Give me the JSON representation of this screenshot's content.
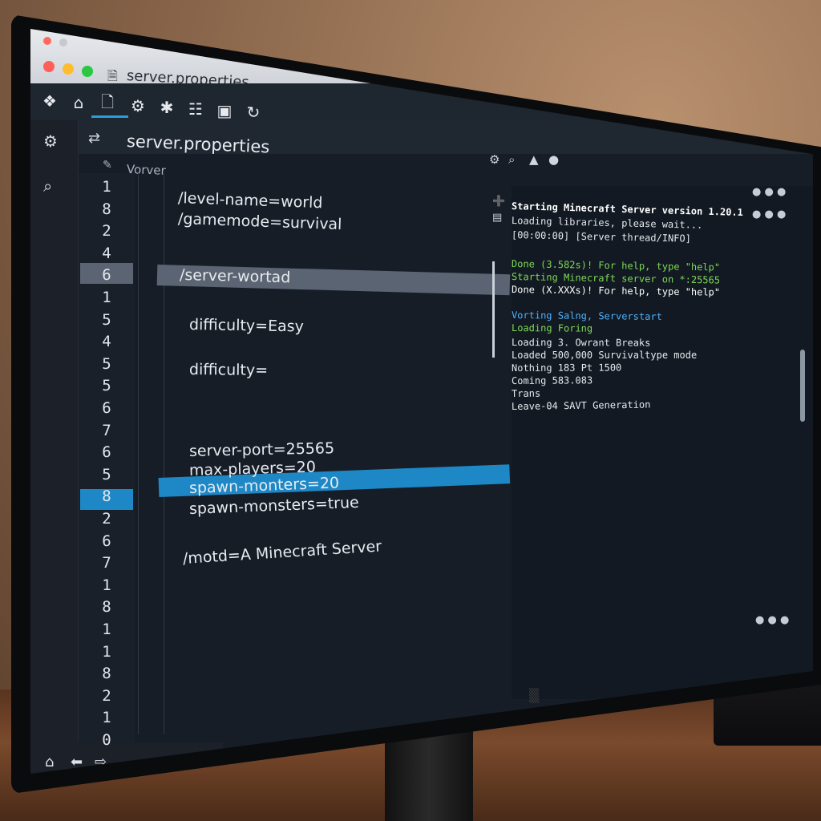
{
  "window": {
    "title": "server.properties"
  },
  "tab": {
    "title": "server.properties"
  },
  "breadcrumb": {
    "text": "Vorver"
  },
  "toolbar": {
    "icons": [
      "extensions-icon",
      "home-icon",
      "file-icon",
      "settings-icon",
      "gear-icon",
      "split-icon",
      "panel-icon",
      "refresh-icon"
    ]
  },
  "activity": {
    "icons": [
      "gear-icon",
      "search-icon"
    ]
  },
  "gutter": {
    "numbers": [
      "1",
      "8",
      "2",
      "4",
      "6",
      "1",
      "5",
      "4",
      "5",
      "5",
      "6",
      "7",
      "6",
      "5",
      "8",
      "2",
      "6",
      "7",
      "1",
      "8",
      "1",
      "1",
      "8",
      "2",
      "1",
      "0"
    ]
  },
  "code": {
    "lines": [
      "/level-name=world",
      "/gamemode=survival",
      "/server-wortad",
      "difficulty=Easy",
      "difficulty=",
      "server-port=25565",
      "max-players=20",
      "spawn-monters=20",
      "spawn-monsters=true",
      "/motd=A Minecraft Server"
    ]
  },
  "console": {
    "lines": [
      "Starting Minecraft Server version 1.20.1",
      "Loading libraries, please wait...",
      "[00:00:00] [Server thread/INFO]",
      "Done (3.582s)! For help, type \"help\"",
      "Starting Minecraft server on *:25565",
      "Done (X.XXXs)! For help, type \"help\"",
      "Vorting Salng, Serverstart",
      "Loading Foring",
      "Loading 3. Owrant Breaks",
      "Loaded 500,000 Survivaltype mode",
      "Nothing 183 Pt 1500",
      "Coming 583.083",
      "Trans",
      "Leave-04 SAVT Generation"
    ]
  },
  "status": {
    "icons": [
      "home-icon",
      "back-icon",
      "forward-icon"
    ]
  },
  "colors": {
    "accent": "#1e88c7",
    "highlight_gray": "#5a6472",
    "console_green": "#7ed957",
    "console_blue": "#4fb3ff"
  }
}
